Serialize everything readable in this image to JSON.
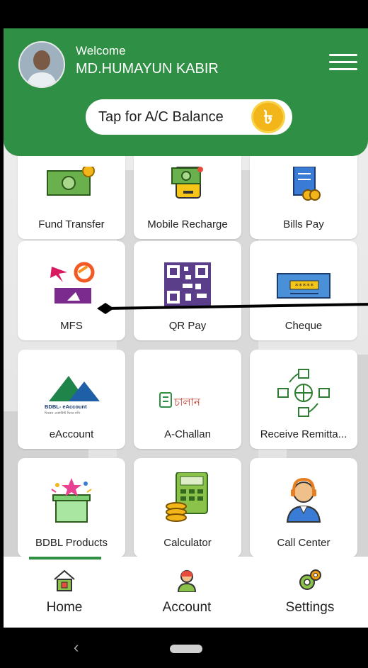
{
  "header": {
    "welcome": "Welcome",
    "user_name": "MD.HUMAYUN KABIR",
    "balance_button": "Tap for A/C Balance",
    "coin_symbol": "৳",
    "brand_color": "#2f8f45"
  },
  "tiles": [
    {
      "label": "Fund Transfer",
      "icon": "fund-transfer-icon"
    },
    {
      "label": "Mobile Recharge",
      "icon": "mobile-recharge-icon"
    },
    {
      "label": "Bills Pay",
      "icon": "bills-pay-icon"
    },
    {
      "label": "MFS",
      "icon": "mfs-icon"
    },
    {
      "label": "QR Pay",
      "icon": "qr-code-icon"
    },
    {
      "label": "Cheque",
      "icon": "cheque-icon"
    },
    {
      "label": "eAccount",
      "icon": "eaccount-logo-icon"
    },
    {
      "label": "A-Challan",
      "icon": "a-challan-icon"
    },
    {
      "label": "Receive Remitta...",
      "icon": "remittance-icon"
    },
    {
      "label": "BDBL Products",
      "icon": "gift-box-icon"
    },
    {
      "label": "Calculator",
      "icon": "calculator-icon"
    },
    {
      "label": "Call Center",
      "icon": "call-center-icon"
    }
  ],
  "icon_text": {
    "eaccount_top": "BDBL- eAccount",
    "eaccount_bottom": "ঘিরেব একাউন্ট ঘিরে বসি",
    "challan": "চালান",
    "cheque_stars": "*****"
  },
  "nav": {
    "home": "Home",
    "account": "Account",
    "settings": "Settings"
  },
  "system_nav": {
    "back": "‹"
  }
}
